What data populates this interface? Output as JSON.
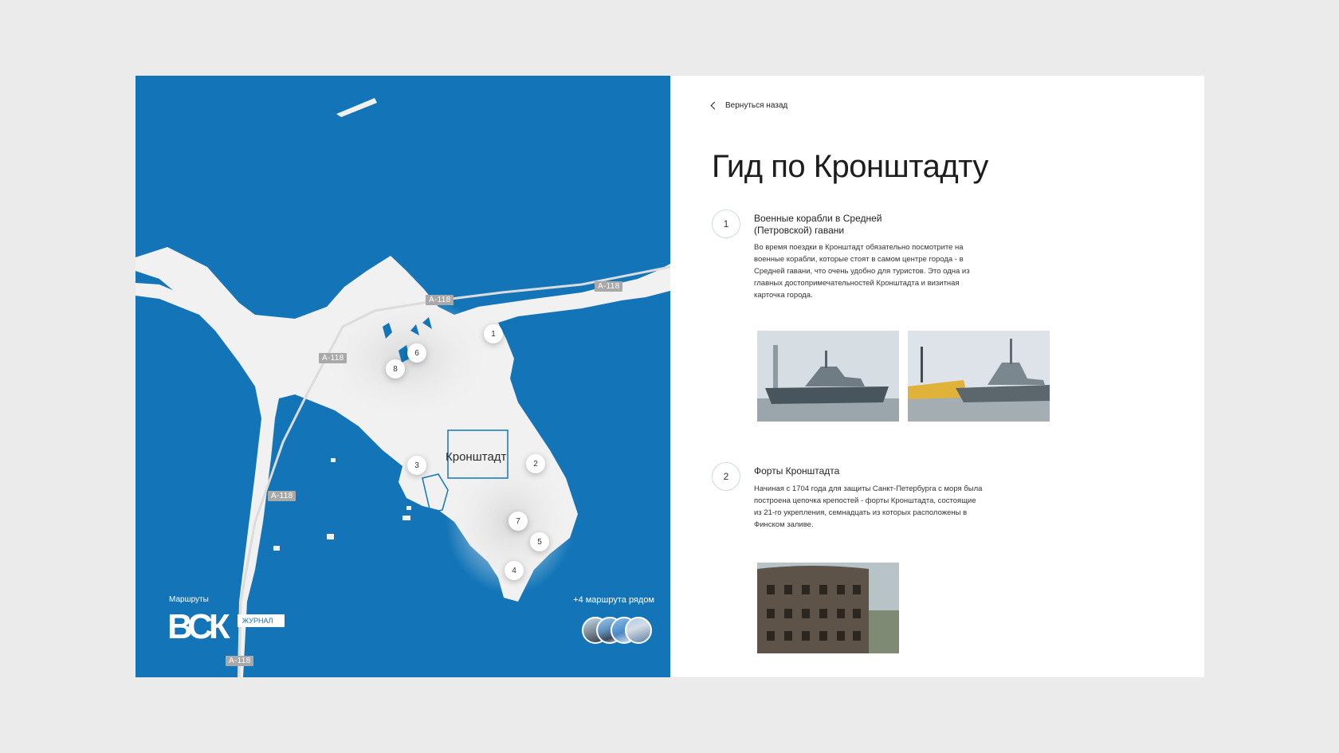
{
  "map": {
    "routes_caption": "Маршруты",
    "logo_text": "ВСК",
    "logo_badge": "ЖУРНАЛ",
    "nearby_routes": "+4 маршрута рядом",
    "city_label": "Кронштадт",
    "road_label": "А-118",
    "pins": [
      "1",
      "2",
      "3",
      "4",
      "5",
      "6",
      "7",
      "8"
    ],
    "colors": {
      "water": "#1375b8",
      "land": "#f1f1f1",
      "road_badge": "#a9a9a9"
    }
  },
  "back_link": "Вернуться назад",
  "page_title": "Гид по Кронштадту",
  "entries": [
    {
      "number": "1",
      "title": "Военные корабли в Средней (Петровской) гавани",
      "text": "Во время поездки в Кронштадт обязательно посмотрите на военные корабли, которые стоят в самом центре города - в Средней гавани, что очень удобно для туристов. Это одна из главных достопримечательностей Кронштадта и визитная карточка города."
    },
    {
      "number": "2",
      "title": "Форты Кронштадта",
      "text": "Начиная с 1704 года для защиты Санкт-Петербурга с моря была построена цепочка крепостей - форты Кронштадта, состоящие из 21-го укрепления, семнадцать из которых расположены в Финском заливе."
    }
  ]
}
